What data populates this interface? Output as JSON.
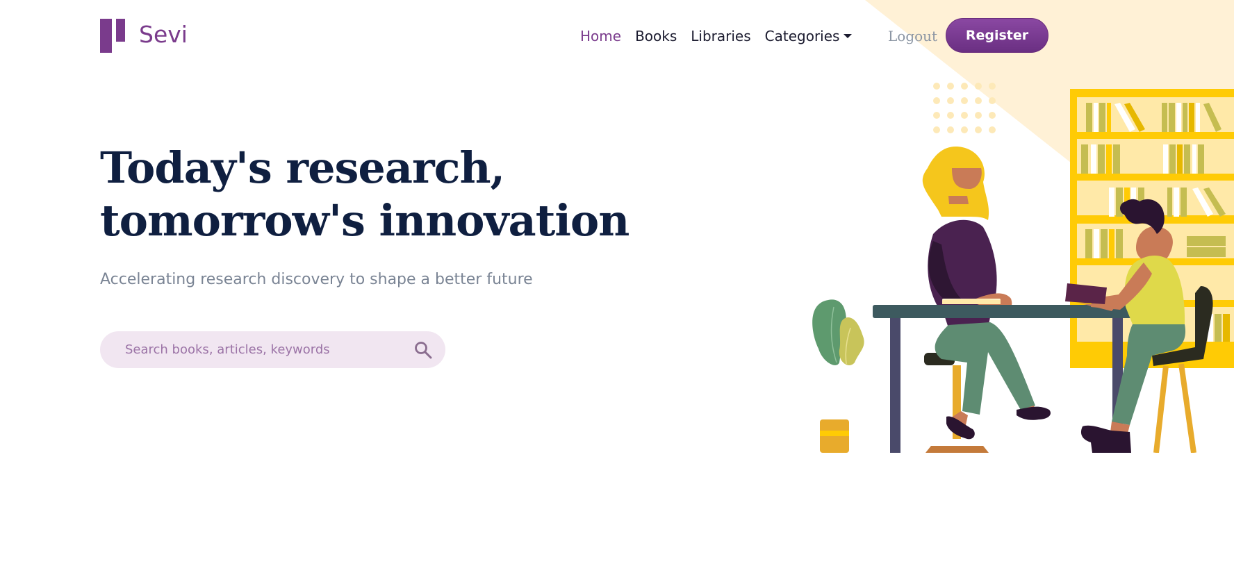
{
  "brand": {
    "name": "Sevi"
  },
  "nav": {
    "items": [
      {
        "label": "Home",
        "active": true
      },
      {
        "label": "Books",
        "active": false
      },
      {
        "label": "Libraries",
        "active": false
      },
      {
        "label": "Categories",
        "active": false,
        "has_dropdown": true
      }
    ],
    "logout_label": "Logout",
    "register_label": "Register"
  },
  "hero": {
    "headline_line1": "Today's research,",
    "headline_line2": "tomorrow's innovation",
    "subtitle": "Accelerating research discovery to shape a better future"
  },
  "search": {
    "placeholder": "Search books, articles, keywords",
    "value": "",
    "icon": "search-icon"
  },
  "colors": {
    "brand": "#7a3b8c",
    "headline": "#0f1f40",
    "search_bg": "#f1e6f1",
    "accent_yellow": "#ffcb05"
  }
}
